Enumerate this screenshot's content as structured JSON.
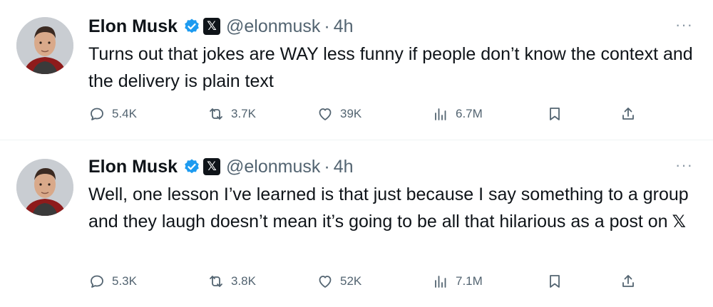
{
  "tweets": [
    {
      "author": {
        "name": "Elon Musk",
        "handle": "@elonmusk"
      },
      "separator": "·",
      "time": "4h",
      "more_label": "···",
      "text": "Turns out that jokes are WAY less funny if people don’t know the context and the delivery is plain text",
      "text_suffix_icon": "",
      "stats": {
        "replies": "5.4K",
        "reposts": "3.7K",
        "likes": "39K",
        "views": "6.7M"
      }
    },
    {
      "author": {
        "name": "Elon Musk",
        "handle": "@elonmusk"
      },
      "separator": "·",
      "time": "4h",
      "more_label": "···",
      "text": "Well, one lesson I’ve learned is that just because I say something to a group and they laugh doesn’t mean it’s going to be all that hilarious as a post on",
      "text_suffix_icon": "𝕏",
      "stats": {
        "replies": "5.3K",
        "reposts": "3.8K",
        "likes": "52K",
        "views": "7.1M"
      }
    }
  ],
  "badges": {
    "verified_color": "#1d9bf0",
    "affiliate_label": "𝕏"
  },
  "icons": [
    "reply-icon",
    "repost-icon",
    "like-icon",
    "views-icon",
    "bookmark-icon",
    "share-icon"
  ]
}
